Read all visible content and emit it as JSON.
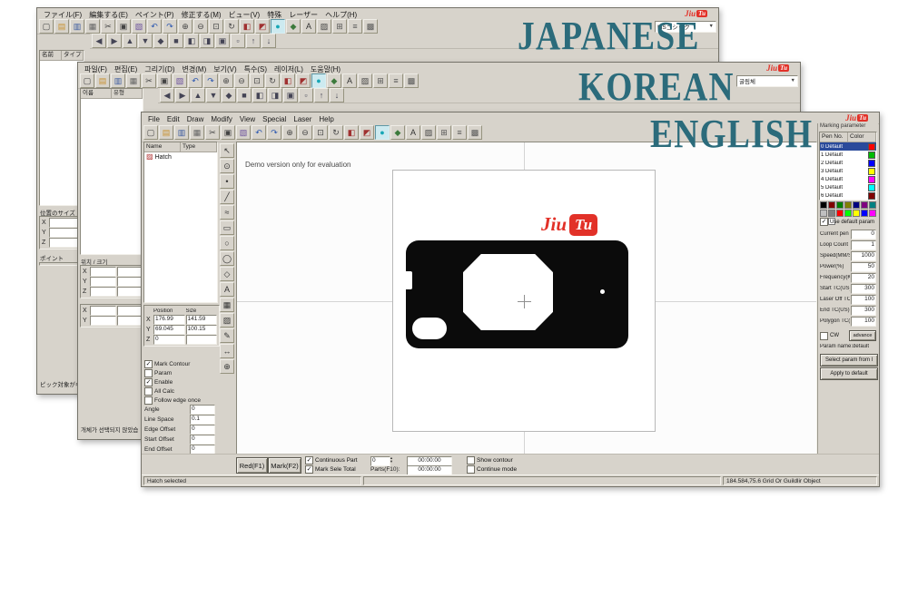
{
  "overlay": {
    "japanese": "JAPANESE",
    "korean": "KOREAN",
    "english": "ENGLISH"
  },
  "logo": {
    "jiu": "Jiu",
    "tu": "Tu"
  },
  "jp": {
    "menu": [
      "ファイル(F)",
      "編集する(E)",
      "ペイント(P)",
      "修正する(M)",
      "ビュー(V)",
      "特殊",
      "レーザー",
      "ヘルプ(H)"
    ],
    "font_combo": "MSゴシック",
    "list_headers": [
      "名前",
      "タイプ"
    ],
    "pos_label": "位置のサイズ",
    "point_label": "ポイント",
    "axes": [
      "X",
      "Y",
      "Z"
    ],
    "status": "ピック対象がな"
  },
  "kr": {
    "menu": [
      "파일(F)",
      "편집(E)",
      "그리기(D)",
      "변경(M)",
      "보기(V)",
      "특수(S)",
      "레이저(L)",
      "도움말(H)"
    ],
    "font_combo": "굴림체",
    "list_headers": [
      "이름",
      "유형"
    ],
    "pos_label": "위치 / 크기",
    "axes": [
      "X",
      "Y",
      "Z"
    ],
    "axes2": [
      "X",
      "Y"
    ],
    "status": "개체가 선택되지 않았습"
  },
  "en": {
    "menu": [
      "File",
      "Edit",
      "Draw",
      "Modify",
      "View",
      "Special",
      "Laser",
      "Help"
    ],
    "list_headers": [
      "Name",
      "Type"
    ],
    "object_name": "Hatch",
    "demo_text": "Demo version only for evaluation",
    "pos_title_1": "Position",
    "pos_title_2": "Size",
    "pos_rows": [
      {
        "axis": "X",
        "v1": "176.99",
        "v2": "141.59"
      },
      {
        "axis": "Y",
        "v1": "69.045",
        "v2": "100.15"
      },
      {
        "axis": "Z",
        "v1": "0",
        "v2": ""
      }
    ],
    "hatch_options": [
      {
        "label": "Mark Contour",
        "selected": true
      },
      {
        "label": "Param",
        "selected": false
      },
      {
        "label": "Enable",
        "selected": true
      },
      {
        "label": "All Calc",
        "selected": false
      },
      {
        "label": "Follow edge once",
        "selected": false
      }
    ],
    "hatch_fields": [
      {
        "label": "Angle",
        "value": "0"
      },
      {
        "label": "Line Space",
        "value": "0.1"
      },
      {
        "label": "Edge Offset",
        "value": "0"
      },
      {
        "label": "Start Offset",
        "value": "0"
      },
      {
        "label": "End Offset",
        "value": "0"
      }
    ],
    "bottom": {
      "red_button": "Red(F1)",
      "mark_button": "Mark(F2)",
      "continuous_part": "Continuous Part",
      "part_count": "0",
      "total_time": "00:00:00",
      "mark_sele_total": "Mark Sele Total",
      "parts_label": "Parts(F10):",
      "parts_time": "00:00:00",
      "show_contour": "Show contour",
      "continue_mode": "Continue mode"
    },
    "status_left": "Hatch selected",
    "status_right": "184.584,75.6 Grid Or Guildlir Object"
  },
  "pens": {
    "title": "Marking parameter",
    "headers": [
      "Pen No.",
      "Color"
    ],
    "rows": [
      {
        "label": "0 Default",
        "color": "#ff0000",
        "selected": true
      },
      {
        "label": "1 Default",
        "color": "#00bb00"
      },
      {
        "label": "2 Default",
        "color": "#0000ff"
      },
      {
        "label": "3 Default",
        "color": "#ffff00"
      },
      {
        "label": "4 Default",
        "color": "#ff00ff"
      },
      {
        "label": "5 Default",
        "color": "#00ffff"
      },
      {
        "label": "6 Default",
        "color": "#800000"
      }
    ],
    "palette": [
      {
        "color": "#000000"
      },
      {
        "color": "#800000"
      },
      {
        "color": "#008000"
      },
      {
        "color": "#808000"
      },
      {
        "color": "#000080"
      },
      {
        "color": "#800080"
      },
      {
        "color": "#008080"
      },
      {
        "color": "#c0c0c0"
      },
      {
        "color": "#808080"
      },
      {
        "color": "#ff0000"
      },
      {
        "color": "#00ff00"
      },
      {
        "color": "#ffff00"
      },
      {
        "color": "#0000ff"
      },
      {
        "color": "#ff00ff"
      },
      {
        "color": "#00ffff"
      },
      {
        "color": "#ffffff"
      }
    ],
    "use_default": "Use default param",
    "params": [
      {
        "label": "Current pen",
        "value": "0"
      },
      {
        "label": "Loop Count",
        "value": "1"
      },
      {
        "label": "Speed(MM/Second)",
        "value": "1000"
      },
      {
        "label": "Power(%)",
        "value": "50"
      },
      {
        "label": "Frequency(KHz)",
        "value": "20"
      },
      {
        "label": "Start TC(US)",
        "value": "300"
      },
      {
        "label": "Laser Off TC(US)",
        "value": "100"
      },
      {
        "label": "End TC(US)",
        "value": "300"
      },
      {
        "label": "Polygon TC(US)",
        "value": "100"
      }
    ],
    "cw_label": "CW",
    "advance_btn": "advance",
    "param_name": "Param name:default",
    "select_btn": "Select param from l",
    "apply_btn": "Apply to default"
  },
  "icons": {
    "toolbar_main": [
      {
        "name": "new-file-icon",
        "glyph": "▢",
        "color": "#444444"
      },
      {
        "name": "open-folder-icon",
        "glyph": "▤",
        "color": "#c89230"
      },
      {
        "name": "save-icon",
        "glyph": "▥",
        "color": "#38589e"
      },
      {
        "name": "print-icon",
        "glyph": "▦",
        "color": "#666666"
      },
      {
        "name": "cut-icon",
        "glyph": "✂",
        "color": "#444444"
      },
      {
        "name": "copy-icon",
        "glyph": "▣",
        "color": "#444444"
      },
      {
        "name": "paste-icon",
        "glyph": "▧",
        "color": "#6b509c"
      },
      {
        "name": "undo-icon",
        "glyph": "↶",
        "color": "#2b57b0"
      },
      {
        "name": "redo-icon",
        "glyph": "↷",
        "color": "#2b57b0"
      },
      {
        "name": "zoom-in-icon",
        "glyph": "⊕",
        "color": "#444444"
      },
      {
        "name": "zoom-out-icon",
        "glyph": "⊖",
        "color": "#444444"
      },
      {
        "name": "zoom-fit-icon",
        "glyph": "⊡",
        "color": "#444444"
      },
      {
        "name": "rotate-icon",
        "glyph": "↻",
        "color": "#444444"
      },
      {
        "name": "mirror-horizontal-icon",
        "glyph": "◧",
        "color": "#a03030"
      },
      {
        "name": "mirror-vertical-icon",
        "glyph": "◩",
        "color": "#a03030"
      },
      {
        "name": "ellipse-icon",
        "glyph": "●",
        "color": "#18a7b6",
        "selected": true
      },
      {
        "name": "polygon-icon",
        "glyph": "◆",
        "color": "#3c7a3c"
      },
      {
        "name": "text-icon",
        "glyph": "A",
        "color": "#333333"
      },
      {
        "name": "hatch-icon",
        "glyph": "▨",
        "color": "#444444"
      },
      {
        "name": "group-icon",
        "glyph": "⊞",
        "color": "#555555"
      },
      {
        "name": "align-icon",
        "glyph": "≡",
        "color": "#555555"
      },
      {
        "name": "fill-icon",
        "glyph": "▩",
        "color": "#555555"
      }
    ],
    "toolbar_second": [
      {
        "name": "align-left-icon",
        "glyph": "◀",
        "color": "#444455"
      },
      {
        "name": "align-right-icon",
        "glyph": "▶",
        "color": "#444455"
      },
      {
        "name": "align-top-icon",
        "glyph": "▲",
        "color": "#444455"
      },
      {
        "name": "align-bottom-icon",
        "glyph": "▼",
        "color": "#444455"
      },
      {
        "name": "align-center-icon",
        "glyph": "◆",
        "color": "#444455"
      },
      {
        "name": "same-size-icon",
        "glyph": "■",
        "color": "#444455"
      },
      {
        "name": "distribute-horizontal-icon",
        "glyph": "◧",
        "color": "#444455"
      },
      {
        "name": "distribute-vertical-icon",
        "glyph": "◨",
        "color": "#444455"
      },
      {
        "name": "lock-icon",
        "glyph": "▣",
        "color": "#444455"
      },
      {
        "name": "unlock-icon",
        "glyph": "▫",
        "color": "#444455"
      },
      {
        "name": "bring-front-icon",
        "glyph": "↑",
        "color": "#444455"
      },
      {
        "name": "send-back-icon",
        "glyph": "↓",
        "color": "#444455"
      }
    ],
    "tools": [
      {
        "name": "select-tool-icon",
        "glyph": "↖"
      },
      {
        "name": "node-edit-tool-icon",
        "glyph": "⊙"
      },
      {
        "name": "point-tool-icon",
        "glyph": "•"
      },
      {
        "name": "line-tool-icon",
        "glyph": "╱"
      },
      {
        "name": "curve-tool-icon",
        "glyph": "≈"
      },
      {
        "name": "rectangle-tool-icon",
        "glyph": "▭"
      },
      {
        "name": "circle-tool-icon",
        "glyph": "○"
      },
      {
        "name": "ellipse-tool-icon",
        "glyph": "◯"
      },
      {
        "name": "polygon-tool-icon",
        "glyph": "◇"
      },
      {
        "name": "text-tool-icon",
        "glyph": "A"
      },
      {
        "name": "bitmap-tool-icon",
        "glyph": "▦"
      },
      {
        "name": "hatch-tool-icon",
        "glyph": "▨"
      },
      {
        "name": "pen-tool-icon",
        "glyph": "✎"
      },
      {
        "name": "dimension-tool-icon",
        "glyph": "↔"
      },
      {
        "name": "zoom-tool-icon",
        "glyph": "⊕"
      }
    ]
  }
}
